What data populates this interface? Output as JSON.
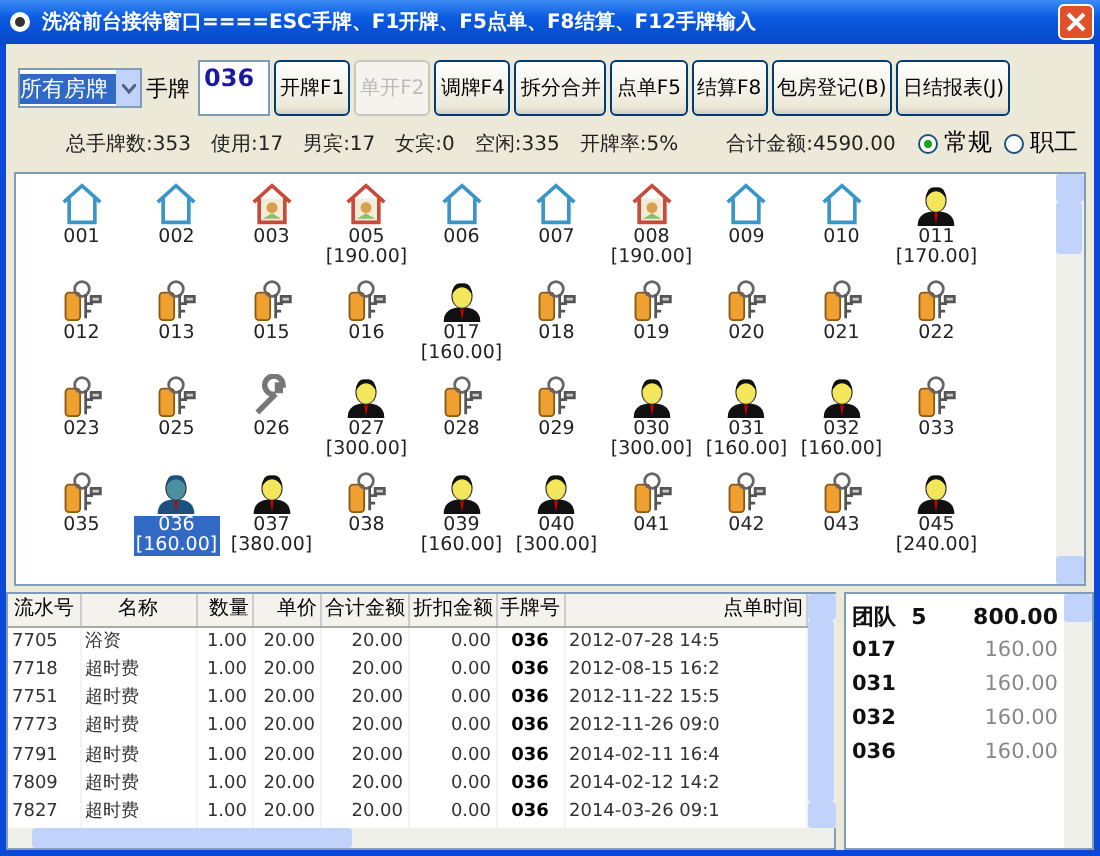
{
  "window": {
    "title": "洗浴前台接待窗口====ESC手牌、F1开牌、F5点单、F8结算、F12手牌输入"
  },
  "toolbar": {
    "filter": {
      "value": "所有房牌"
    },
    "card_label": "手牌",
    "card_input": {
      "value": "036"
    },
    "buttons": [
      {
        "label": "开牌F1",
        "disabled": false
      },
      {
        "label": "单开F2",
        "disabled": true
      },
      {
        "label": "调牌F4",
        "disabled": false
      },
      {
        "label": "拆分合并",
        "disabled": false
      },
      {
        "label": "点单F5",
        "disabled": false
      },
      {
        "label": "结算F8",
        "disabled": false
      },
      {
        "label": "包房登记(B)",
        "disabled": false
      },
      {
        "label": "日结报表(J)",
        "disabled": false
      }
    ]
  },
  "stats": [
    "总手牌数:353",
    "使用:17",
    "男宾:17",
    "女宾:0",
    "空闲:335",
    "开牌率:5%",
    "合计金额:4590.00"
  ],
  "modes": [
    {
      "label": "常规",
      "selected": true
    },
    {
      "label": "职工",
      "selected": false
    }
  ],
  "cards": [
    {
      "label": "001",
      "kind": "house",
      "selected": false
    },
    {
      "label": "002",
      "kind": "house",
      "selected": false
    },
    {
      "label": "003",
      "kind": "room",
      "selected": false
    },
    {
      "label": "005",
      "amount": "[190.00]",
      "kind": "room",
      "selected": false
    },
    {
      "label": "006",
      "kind": "house",
      "selected": false
    },
    {
      "label": "007",
      "kind": "house",
      "selected": false
    },
    {
      "label": "008",
      "amount": "[190.00]",
      "kind": "room",
      "selected": false
    },
    {
      "label": "009",
      "kind": "house",
      "selected": false
    },
    {
      "label": "010",
      "kind": "house",
      "selected": false
    },
    {
      "label": "011",
      "amount": "[170.00]",
      "kind": "guest",
      "selected": false
    },
    {
      "label": "012",
      "kind": "key",
      "selected": false
    },
    {
      "label": "013",
      "kind": "key",
      "selected": false
    },
    {
      "label": "015",
      "kind": "key",
      "selected": false
    },
    {
      "label": "016",
      "kind": "key",
      "selected": false
    },
    {
      "label": "017",
      "amount": "[160.00]",
      "kind": "guest",
      "selected": false
    },
    {
      "label": "018",
      "kind": "key",
      "selected": false
    },
    {
      "label": "019",
      "kind": "key",
      "selected": false
    },
    {
      "label": "020",
      "kind": "key",
      "selected": false
    },
    {
      "label": "021",
      "kind": "key",
      "selected": false
    },
    {
      "label": "022",
      "kind": "key",
      "selected": false
    },
    {
      "label": "023",
      "kind": "key",
      "selected": false
    },
    {
      "label": "025",
      "kind": "key",
      "selected": false
    },
    {
      "label": "026",
      "kind": "wrench",
      "selected": false
    },
    {
      "label": "027",
      "amount": "[300.00]",
      "kind": "guest",
      "selected": false
    },
    {
      "label": "028",
      "kind": "key",
      "selected": false
    },
    {
      "label": "029",
      "kind": "key",
      "selected": false
    },
    {
      "label": "030",
      "amount": "[300.00]",
      "kind": "guest",
      "selected": false
    },
    {
      "label": "031",
      "amount": "[160.00]",
      "kind": "guest",
      "selected": false
    },
    {
      "label": "032",
      "amount": "[160.00]",
      "kind": "guest",
      "selected": false
    },
    {
      "label": "033",
      "kind": "key",
      "selected": false
    },
    {
      "label": "035",
      "kind": "key",
      "selected": false
    },
    {
      "label": "036",
      "amount": "[160.00]",
      "kind": "guest",
      "selected": true
    },
    {
      "label": "037",
      "amount": "[380.00]",
      "kind": "guest",
      "selected": false
    },
    {
      "label": "038",
      "kind": "key",
      "selected": false
    },
    {
      "label": "039",
      "amount": "[160.00]",
      "kind": "guest",
      "selected": false
    },
    {
      "label": "040",
      "amount": "[300.00]",
      "kind": "guest",
      "selected": false
    },
    {
      "label": "041",
      "kind": "key",
      "selected": false
    },
    {
      "label": "042",
      "kind": "key",
      "selected": false
    },
    {
      "label": "043",
      "kind": "key",
      "selected": false
    },
    {
      "label": "045",
      "amount": "[240.00]",
      "kind": "guest",
      "selected": false
    }
  ],
  "orders": {
    "columns": [
      "流水号",
      "名称",
      "数量",
      "单价",
      "合计金额",
      "折扣金额",
      "手牌号",
      "点单时间"
    ],
    "rows": [
      [
        "7705",
        "浴资",
        "1.00",
        "20.00",
        "20.00",
        "0.00",
        "036",
        "2012-07-28 14:5"
      ],
      [
        "7718",
        "超时费",
        "1.00",
        "20.00",
        "20.00",
        "0.00",
        "036",
        "2012-08-15 16:2"
      ],
      [
        "7751",
        "超时费",
        "1.00",
        "20.00",
        "20.00",
        "0.00",
        "036",
        "2012-11-22 15:5"
      ],
      [
        "7773",
        "超时费",
        "1.00",
        "20.00",
        "20.00",
        "0.00",
        "036",
        "2012-11-26 09:0"
      ],
      [
        "7791",
        "超时费",
        "1.00",
        "20.00",
        "20.00",
        "0.00",
        "036",
        "2014-02-11 16:4"
      ],
      [
        "7809",
        "超时费",
        "1.00",
        "20.00",
        "20.00",
        "0.00",
        "036",
        "2014-02-12 14:2"
      ],
      [
        "7827",
        "超时费",
        "1.00",
        "20.00",
        "20.00",
        "0.00",
        "036",
        "2014-03-26 09:1"
      ]
    ]
  },
  "team": {
    "header": {
      "name": "团队",
      "count": "5",
      "total": "800.00"
    },
    "rows": [
      {
        "card": "017",
        "amount": "160.00"
      },
      {
        "card": "031",
        "amount": "160.00"
      },
      {
        "card": "032",
        "amount": "160.00"
      },
      {
        "card": "036",
        "amount": "160.00"
      }
    ]
  }
}
